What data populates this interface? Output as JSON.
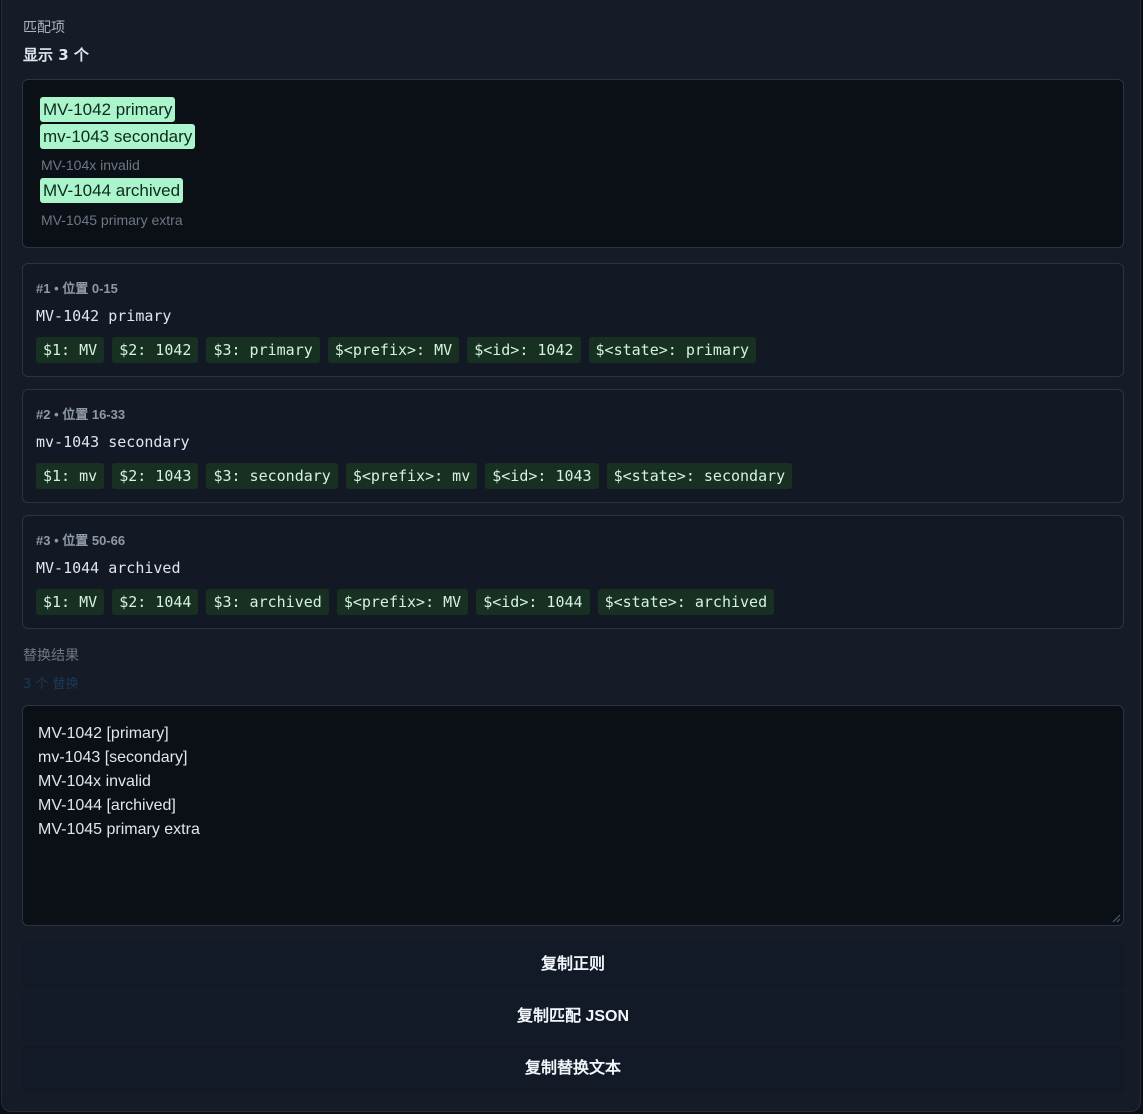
{
  "matches_section": {
    "label": "匹配项",
    "count_label": "显示 3 个"
  },
  "preview_lines": [
    {
      "text": "MV-1042 primary",
      "matched": true
    },
    {
      "text": "mv-1043 secondary",
      "matched": true
    },
    {
      "text": "MV-104x invalid",
      "matched": false
    },
    {
      "text": "MV-1044 archived",
      "matched": true
    },
    {
      "text": "MV-1045 primary extra",
      "matched": false
    }
  ],
  "matches": [
    {
      "header": "#1 • 位置 0-15",
      "text": "MV-1042 primary",
      "groups": [
        "$1: MV",
        "$2: 1042",
        "$3: primary",
        "$<prefix>: MV",
        "$<id>: 1042",
        "$<state>: primary"
      ]
    },
    {
      "header": "#2 • 位置 16-33",
      "text": "mv-1043 secondary",
      "groups": [
        "$1: mv",
        "$2: 1043",
        "$3: secondary",
        "$<prefix>: mv",
        "$<id>: 1043",
        "$<state>: secondary"
      ]
    },
    {
      "header": "#3 • 位置 50-66",
      "text": "MV-1044 archived",
      "groups": [
        "$1: MV",
        "$2: 1044",
        "$3: archived",
        "$<prefix>: MV",
        "$<id>: 1044",
        "$<state>: archived"
      ]
    }
  ],
  "replace_section": {
    "label": "替换结果",
    "faint_note": "3 个 替换"
  },
  "replace_output": [
    "MV-1042 [primary]",
    "mv-1043 [secondary]",
    "MV-104x invalid",
    "MV-1044 [archived]",
    "MV-1045 primary extra"
  ],
  "buttons": {
    "copy_regex": "复制正则",
    "copy_json": "复制匹配 JSON",
    "copy_replaced": "复制替换文本"
  }
}
